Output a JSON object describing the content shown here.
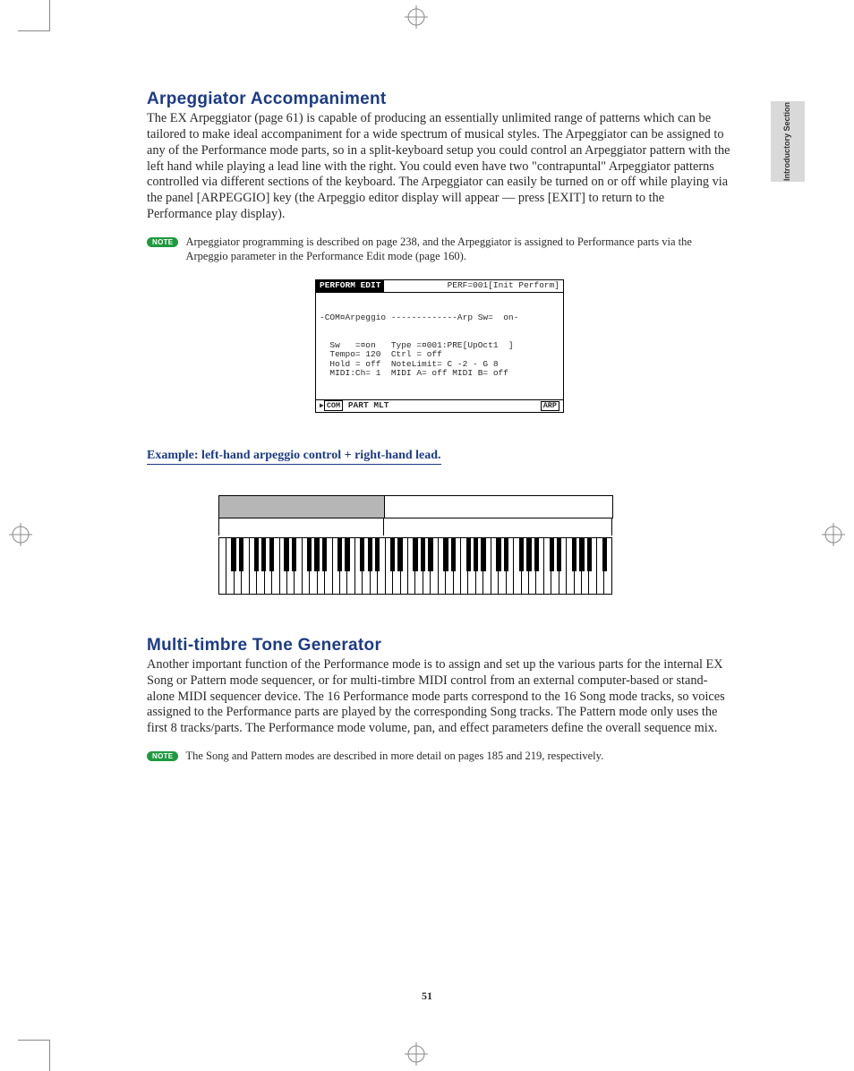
{
  "sideTab": "Introductory Section",
  "section1": {
    "heading": "Arpeggiator Accompaniment",
    "body": "The EX Arpeggiator (page 61) is capable of producing an essentially unlimited range of patterns which can be tailored to make ideal accompaniment for a wide spectrum of musical styles. The Arpeggiator can be assigned to any of the Performance mode parts, so in a split-keyboard setup you could control an Arpeggiator pattern with the left hand while playing a lead line with the right. You could even have two \"contrapuntal\" Arpeggiator patterns controlled via different sections of the keyboard. The Arpeggiator can easily be turned on or off while playing via the panel [ARPEGGIO] key (the Arpeggio editor display will appear — press [EXIT] to return to the Performance play display).",
    "noteLabel": "NOTE",
    "noteText": "Arpeggiator programming is described on page 238, and the Arpeggiator is assigned to Performance parts via the Arpeggio parameter in the Performance Edit mode (page 160).",
    "lcd": {
      "topTab": "PERFORM EDIT",
      "topRight": "PERF=001[Init Perform]",
      "line1": "-COM¤Arpeggio -------------Arp Sw=  on-",
      "body": "  Sw   =¤on   Type =¤001:PRE[UpOct1  ]\n  Tempo= 120  Ctrl = off\n  Hold = off  NoteLimit= C -2 - G 8\n  MIDI:Ch= 1  MIDI A= off MIDI B= off",
      "bottomLeft": "COM",
      "bottomMid": "PART MLT",
      "bottomRight": "ARP"
    },
    "exampleCaption": "Example: left-hand arpeggio control + right-hand lead."
  },
  "section2": {
    "heading": "Multi-timbre Tone Generator",
    "body": "Another important function of the Performance mode is to assign and set up the various parts for the internal EX Song or Pattern mode sequencer, or for multi-timbre MIDI control from an external computer-based or stand-alone MIDI sequencer device. The 16 Performance mode parts correspond to the 16 Song mode tracks, so voices assigned to the Performance parts are played by the corresponding Song tracks. The Pattern mode only uses the first 8 tracks/parts. The Performance mode volume, pan, and effect parameters define the overall sequence mix.",
    "noteLabel": "NOTE",
    "noteText": "The Song and Pattern modes are described in more detail on pages 185 and 219, respectively."
  },
  "pageNumber": "51",
  "keyboard": {
    "whiteKeys": 52,
    "octaves": 7,
    "extraBlacks": [
      3
    ]
  }
}
